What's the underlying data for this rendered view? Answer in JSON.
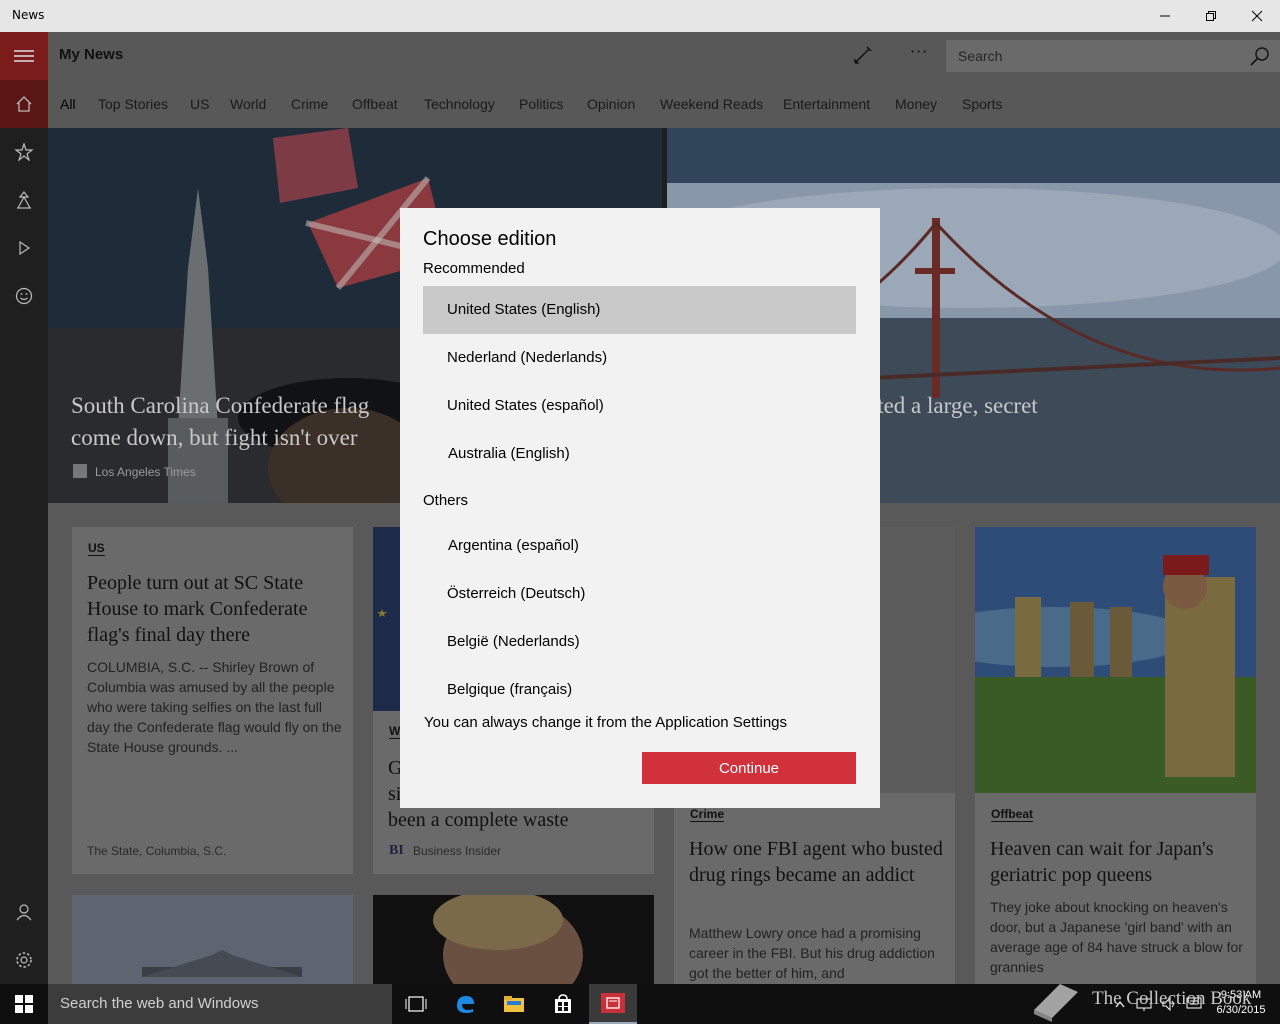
{
  "window": {
    "title": "News",
    "min_icon": "minimize-icon",
    "max_icon": "restore-icon",
    "close_icon": "close-icon"
  },
  "header": {
    "title": "My News",
    "search_placeholder": "Search"
  },
  "tabs": [
    "All",
    "Top Stories",
    "US",
    "World",
    "Crime",
    "Offbeat",
    "Technology",
    "Politics",
    "Opinion",
    "Weekend Reads",
    "Entertainment",
    "Money",
    "Sports"
  ],
  "hero": {
    "left": {
      "line1": "South Carolina Confederate flag",
      "line2": "come down, but fight isn't over",
      "source": "Los Angeles Times"
    },
    "right": {
      "line1": "cted a large, secret",
      "line2": "t"
    }
  },
  "cards": {
    "c1": {
      "category": "US",
      "headline": "People turn out at SC State House to mark Confederate flag's final day there",
      "body": "COLUMBIA, S.C. -- Shirley Brown of Columbia was amused by all the people who were taking selfies on the last full day the Confederate flag would fly on the State House grounds. ...",
      "source": "The State, Columbia, S.C."
    },
    "c2": {
      "cat_partial": "W",
      "line1": "G",
      "line2": "si",
      "line3": "been a complete waste",
      "source_logo": "BI",
      "source": "Business Insider"
    },
    "c3": {
      "category": "Crime",
      "headline": "How one FBI agent who busted drug rings became an addict",
      "body": "Matthew Lowry once had a promising career in the FBI. But his drug addiction got the better of him, and"
    },
    "c4": {
      "category": "Offbeat",
      "headline": "Heaven can wait for Japan's geriatric pop queens",
      "body": "They joke about knocking on heaven's door, but a Japanese 'girl band' with an average age of 84 have struck a blow for grannies"
    }
  },
  "dialog": {
    "title": "Choose edition",
    "recommended_label": "Recommended",
    "recommended": [
      "United States (English)",
      "Nederland (Nederlands)",
      "United States (español)",
      "Australia (English)"
    ],
    "others_label": "Others",
    "others": [
      "Argentina (español)",
      "Österreich (Deutsch)",
      "België (Nederlands)",
      "Belgique (français)"
    ],
    "note": "You can always change it from the Application Settings",
    "continue_label": "Continue",
    "selected_index": 0
  },
  "taskbar": {
    "search_text": "Search the web and Windows",
    "time": "9:53 AM",
    "date": "6/30/2015"
  },
  "watermark": "The Collection Book",
  "colors": {
    "accent": "#d1313b",
    "rail_active": "#7a1c1c"
  }
}
